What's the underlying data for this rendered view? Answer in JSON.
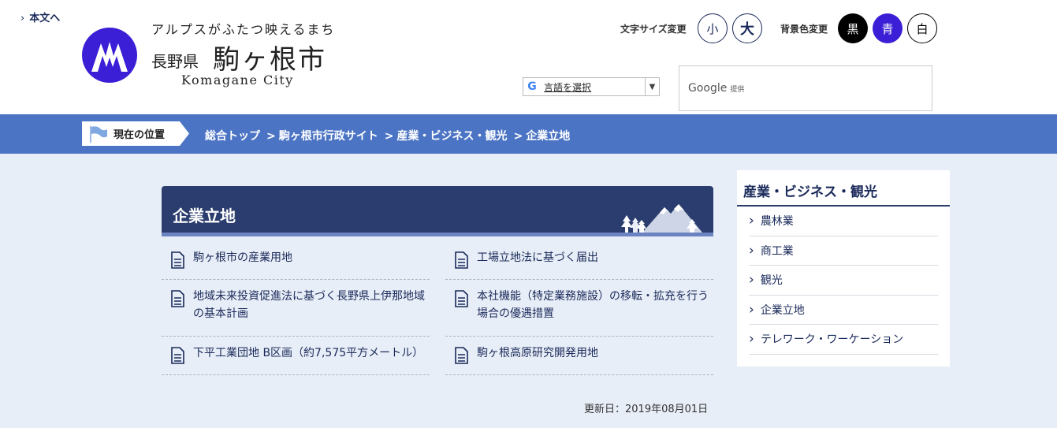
{
  "header": {
    "skip_link": "本文へ",
    "tagline": "アルプスがふたつ映えるまち",
    "prefecture": "長野県",
    "city_name": "駒ヶ根市",
    "city_name_en": "Komagane City",
    "font_size_label": "文字サイズ変更",
    "font_small": "小",
    "font_large": "大",
    "bg_label": "背景色変更",
    "bg_black": "黒",
    "bg_blue": "青",
    "bg_white": "白",
    "translate_label": "言語を選択",
    "search_brand": "Google",
    "search_provided": "提供"
  },
  "breadcrumb": {
    "here_label": "現在の位置",
    "items": [
      "総合トップ",
      "駒ヶ根市行政サイト",
      "産業・ビジネス・観光"
    ],
    "current": "企業立地"
  },
  "main": {
    "title": "企業立地",
    "links": [
      "駒ヶ根市の産業用地",
      "工場立地法に基づく届出",
      "地域未来投資促進法に基づく長野県上伊那地域の基本計画",
      "本社機能（特定業務施設）の移転・拡充を行う場合の優遇措置",
      "下平工業団地 B区画（約7,575平方メートル）",
      "駒ヶ根高原研究開発用地"
    ],
    "updated": "更新日：2019年08月01日"
  },
  "sidebar": {
    "title": "産業・ビジネス・観光",
    "items": [
      "農林業",
      "商工業",
      "観光",
      "企業立地",
      "テレワーク・ワーケーション"
    ]
  },
  "colors": {
    "crumb_bar": "#4c74c4",
    "title_bar": "#2b3d6e",
    "brand_blue": "#3b1fd6",
    "page_bg": "#e8eef7"
  }
}
